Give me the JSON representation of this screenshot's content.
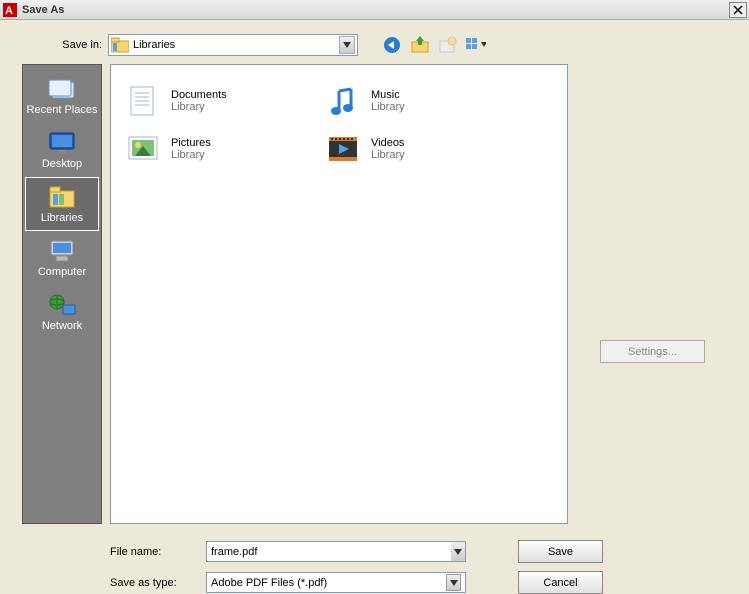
{
  "title": "Save As",
  "saveInLabel": "Save in:",
  "saveInValue": "Libraries",
  "sidebar": {
    "items": [
      {
        "label": "Recent Places"
      },
      {
        "label": "Desktop"
      },
      {
        "label": "Libraries"
      },
      {
        "label": "Computer"
      },
      {
        "label": "Network"
      }
    ]
  },
  "libraries": [
    {
      "name": "Documents",
      "sub": "Library"
    },
    {
      "name": "Music",
      "sub": "Library"
    },
    {
      "name": "Pictures",
      "sub": "Library"
    },
    {
      "name": "Videos",
      "sub": "Library"
    }
  ],
  "settingsLabel": "Settings...",
  "fileNameLabel": "File name:",
  "fileNameValue": "frame.pdf",
  "saveTypeLabel": "Save as type:",
  "saveTypeValue": "Adobe PDF Files (*.pdf)",
  "saveBtn": "Save",
  "cancelBtn": "Cancel"
}
